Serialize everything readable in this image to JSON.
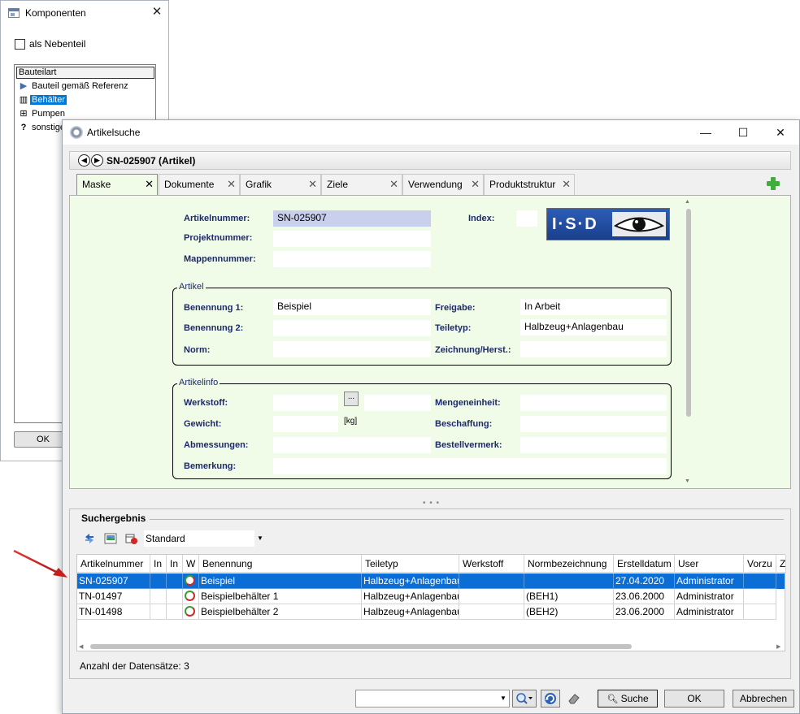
{
  "komponenten": {
    "title": "Komponenten",
    "checkbox_label": "als Nebenteil",
    "tree_header": "Bauteilart",
    "items": [
      {
        "label": "Bauteil gemäß Referenz",
        "icon": "triangle-right-icon"
      },
      {
        "label": "Behälter",
        "icon": "container-icon",
        "selected": true
      },
      {
        "label": "Pumpen",
        "icon": "pump-icon"
      },
      {
        "label": "sonstige",
        "icon": "question-icon"
      }
    ],
    "ok_label": "OK"
  },
  "main": {
    "title": "Artikelsuche",
    "header_title": "SN-025907 (Artikel)",
    "tabs": [
      {
        "label": "Maske",
        "active": true
      },
      {
        "label": "Dokumente"
      },
      {
        "label": "Grafik"
      },
      {
        "label": "Ziele"
      },
      {
        "label": "Verwendung"
      },
      {
        "label": "Produktstruktur"
      }
    ],
    "logo_text": "I·S·D",
    "form": {
      "artikelnummer_label": "Artikelnummer:",
      "artikelnummer_value": "SN-025907",
      "projektnummer_label": "Projektnummer:",
      "mappennummer_label": "Mappennummer:",
      "index_label": "Index:",
      "artikel_group": "Artikel",
      "benennung1_label": "Benennung 1:",
      "benennung1_value": "Beispiel",
      "benennung2_label": "Benennung 2:",
      "norm_label": "Norm:",
      "freigabe_label": "Freigabe:",
      "freigabe_value": "In Arbeit",
      "teiletyp_label": "Teiletyp:",
      "teiletyp_value": "Halbzeug+Anlagenbau",
      "zeichnung_label": "Zeichnung/Herst.:",
      "artikelinfo_group": "Artikelinfo",
      "werkstoff_label": "Werkstoff:",
      "werkstoff_btn": "...",
      "gewicht_label": "Gewicht:",
      "gewicht_unit": "[kg]",
      "abmessungen_label": "Abmessungen:",
      "bemerkung_label": "Bemerkung:",
      "mengeneinheit_label": "Mengeneinheit:",
      "beschaffung_label": "Beschaffung:",
      "bestellvermerk_label": "Bestellvermerk:"
    },
    "results": {
      "title": "Suchergebnis",
      "view_combo": "Standard",
      "columns": [
        "Artikelnummer",
        "In",
        "In",
        "W",
        "Benennung",
        "Teiletyp",
        "Werkstoff",
        "Normbezeichnung",
        "Erstelldatum",
        "User",
        "Vorzu",
        "Z"
      ],
      "rows": [
        {
          "artikelnummer": "SN-025907",
          "benennung": "Beispiel",
          "teiletyp": "Halbzeug+Anlagenbau",
          "werkstoff": "",
          "norm": "",
          "datum": "27.04.2020",
          "user": "Administrator",
          "selected": true
        },
        {
          "artikelnummer": "TN-01497",
          "benennung": "Beispielbehälter 1",
          "teiletyp": "Halbzeug+Anlagenbau",
          "werkstoff": "",
          "norm": "(BEH1)",
          "datum": "23.06.2000",
          "user": "Administrator"
        },
        {
          "artikelnummer": "TN-01498",
          "benennung": "Beispielbehälter 2",
          "teiletyp": "Halbzeug+Anlagenbau",
          "werkstoff": "",
          "norm": "(BEH2)",
          "datum": "23.06.2000",
          "user": "Administrator"
        }
      ],
      "count_label": "Anzahl der Datensätze: 3"
    },
    "bottom": {
      "search_label": "Suche",
      "ok_label": "OK",
      "cancel_label": "Abbrechen"
    },
    "colors": {
      "form_bg": "#f0fbe8",
      "label_color": "#1c2a6b",
      "selection": "#0b6ed6",
      "arrow": "#d42424"
    }
  }
}
